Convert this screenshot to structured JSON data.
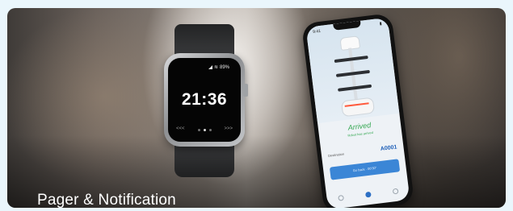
{
  "caption": "Pager & Notification",
  "watch": {
    "status_battery": "89%",
    "time": "21:36",
    "nav_left": "<<<",
    "nav_right": ">>>"
  },
  "phone": {
    "status_time": "9:41",
    "arrived_title": "Arrived",
    "arrived_subtitle": "Robot has arrived",
    "destination_label": "Destination",
    "destination_code": "A0001",
    "action_button": "Go back · 00'30\""
  }
}
